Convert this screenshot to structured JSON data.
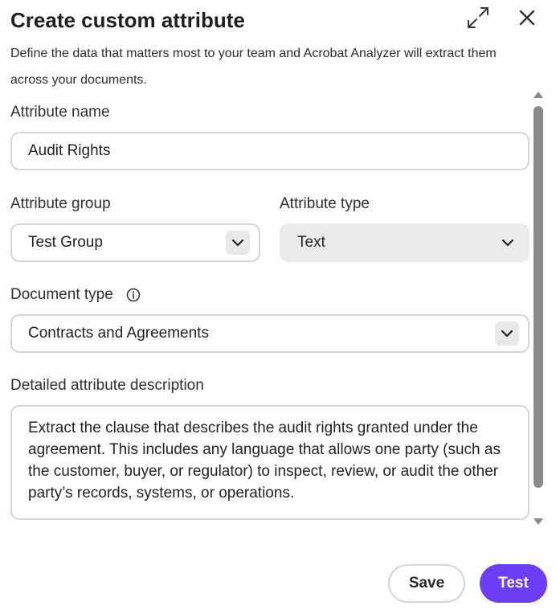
{
  "dialog": {
    "title": "Create custom attribute",
    "subtitle": "Define the data that matters most to your team and Acrobat Analyzer will extract them across your documents.",
    "expand_icon": "expand-arrows-icon",
    "close_icon": "close-icon"
  },
  "fields": {
    "attribute_name": {
      "label": "Attribute name",
      "value": "Audit Rights"
    },
    "attribute_group": {
      "label": "Attribute group",
      "value": "Test Group",
      "icon": "chevron-down-icon"
    },
    "attribute_type": {
      "label": "Attribute type",
      "value": "Text",
      "state": "disabled",
      "icon": "chevron-down-icon"
    },
    "document_type": {
      "label": "Document type",
      "info_icon": "info-icon",
      "value": "Contracts and Agreements",
      "icon": "chevron-down-icon"
    },
    "description": {
      "label": "Detailed attribute description",
      "value": "Extract the clause that describes the audit rights granted under the agreement. This includes any language that allows one party (such as the customer, buyer, or regulator) to inspect, review, or audit the other party’s records, systems, or operations."
    }
  },
  "footer": {
    "save_label": "Save",
    "test_label": "Test"
  },
  "colors": {
    "accent": "#6c3df4",
    "border": "#d5d5d5",
    "disabled_bg": "#ebebeb",
    "scroll_thumb": "#8a8a8a"
  }
}
